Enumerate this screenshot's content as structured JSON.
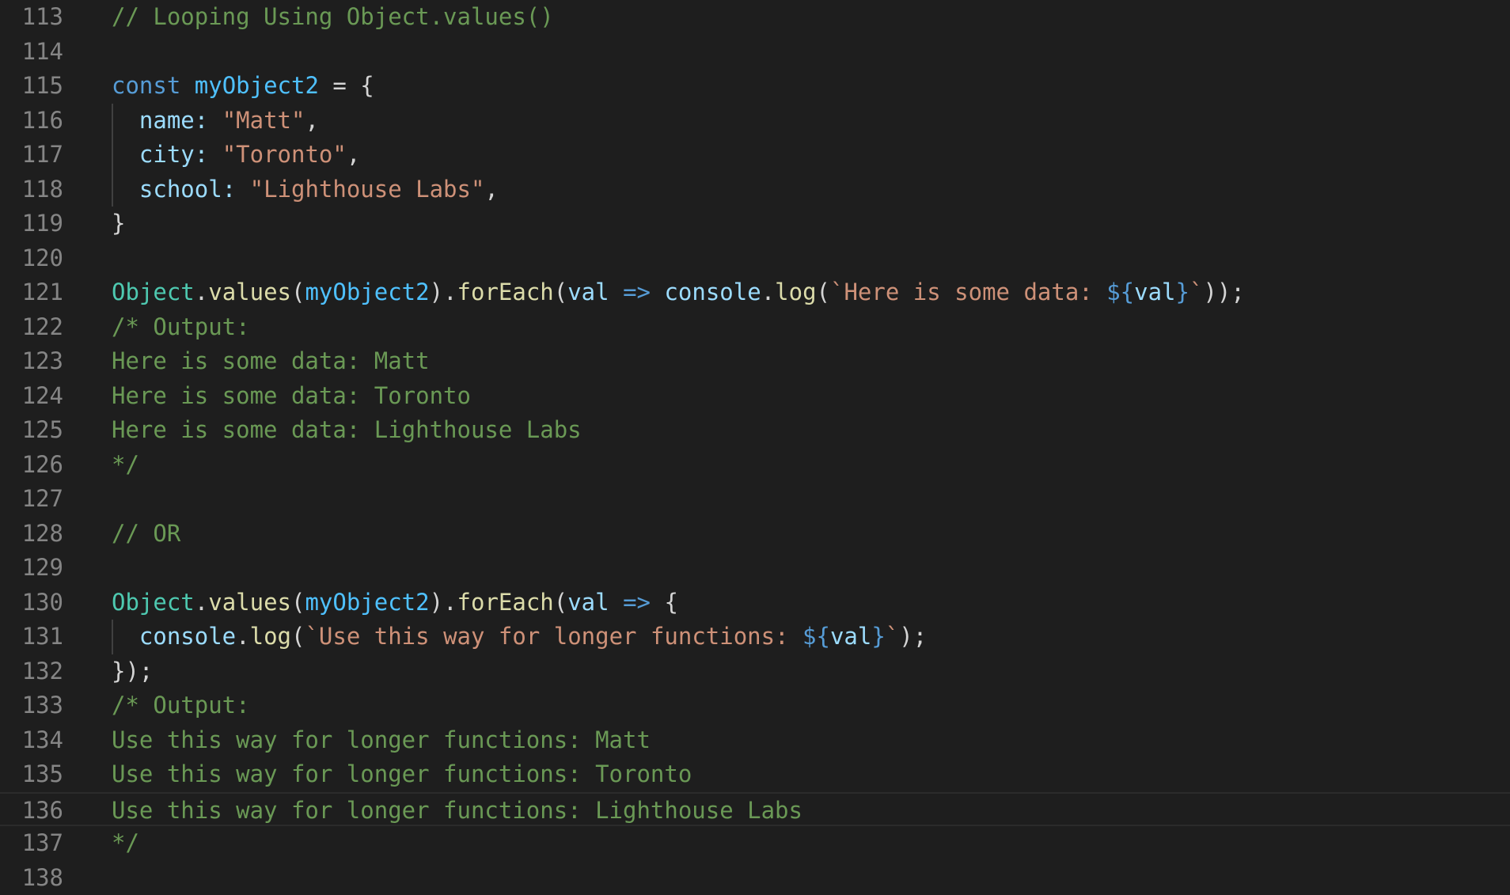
{
  "editor": {
    "colors": {
      "background": "#1e1e1e",
      "line_number": "#858585",
      "comment": "#6a9955",
      "keyword": "#569cd6",
      "variable": "#4fc1ff",
      "parameter": "#9cdcfe",
      "string": "#ce9178",
      "class": "#4ec9b0",
      "function": "#dcdcaa",
      "plain": "#d4d4d4"
    },
    "current_line": 136,
    "lines": [
      {
        "number": "113",
        "tokens": [
          {
            "t": "// Looping Using Object.values()",
            "c": "comment"
          }
        ]
      },
      {
        "number": "114",
        "tokens": []
      },
      {
        "number": "115",
        "tokens": [
          {
            "t": "const",
            "c": "keyword"
          },
          {
            "t": " ",
            "c": "plain"
          },
          {
            "t": "myObject2",
            "c": "var"
          },
          {
            "t": " = {",
            "c": "plain"
          }
        ]
      },
      {
        "number": "116",
        "guide": true,
        "tokens": [
          {
            "t": "  ",
            "c": "plain"
          },
          {
            "t": "name",
            "c": "param"
          },
          {
            "t": ": ",
            "c": "param"
          },
          {
            "t": "\"Matt\"",
            "c": "string"
          },
          {
            "t": ",",
            "c": "plain"
          }
        ]
      },
      {
        "number": "117",
        "guide": true,
        "tokens": [
          {
            "t": "  ",
            "c": "plain"
          },
          {
            "t": "city",
            "c": "param"
          },
          {
            "t": ": ",
            "c": "param"
          },
          {
            "t": "\"Toronto\"",
            "c": "string"
          },
          {
            "t": ",",
            "c": "plain"
          }
        ]
      },
      {
        "number": "118",
        "guide": true,
        "tokens": [
          {
            "t": "  ",
            "c": "plain"
          },
          {
            "t": "school",
            "c": "param"
          },
          {
            "t": ": ",
            "c": "param"
          },
          {
            "t": "\"Lighthouse Labs\"",
            "c": "string"
          },
          {
            "t": ",",
            "c": "plain"
          }
        ]
      },
      {
        "number": "119",
        "tokens": [
          {
            "t": "}",
            "c": "plain"
          }
        ]
      },
      {
        "number": "120",
        "tokens": []
      },
      {
        "number": "121",
        "tokens": [
          {
            "t": "Object",
            "c": "class"
          },
          {
            "t": ".",
            "c": "plain"
          },
          {
            "t": "values",
            "c": "func"
          },
          {
            "t": "(",
            "c": "plain"
          },
          {
            "t": "myObject2",
            "c": "var"
          },
          {
            "t": ").",
            "c": "plain"
          },
          {
            "t": "forEach",
            "c": "func"
          },
          {
            "t": "(",
            "c": "plain"
          },
          {
            "t": "val",
            "c": "param"
          },
          {
            "t": " ",
            "c": "plain"
          },
          {
            "t": "=>",
            "c": "keyword"
          },
          {
            "t": " ",
            "c": "plain"
          },
          {
            "t": "console",
            "c": "param"
          },
          {
            "t": ".",
            "c": "plain"
          },
          {
            "t": "log",
            "c": "func"
          },
          {
            "t": "(",
            "c": "plain"
          },
          {
            "t": "`Here is some data: ",
            "c": "string"
          },
          {
            "t": "${",
            "c": "keyword"
          },
          {
            "t": "val",
            "c": "param"
          },
          {
            "t": "}",
            "c": "keyword"
          },
          {
            "t": "`",
            "c": "string"
          },
          {
            "t": "));",
            "c": "plain"
          }
        ]
      },
      {
        "number": "122",
        "tokens": [
          {
            "t": "/* Output:",
            "c": "comment"
          }
        ]
      },
      {
        "number": "123",
        "tokens": [
          {
            "t": "Here is some data: Matt",
            "c": "comment"
          }
        ]
      },
      {
        "number": "124",
        "tokens": [
          {
            "t": "Here is some data: Toronto",
            "c": "comment"
          }
        ]
      },
      {
        "number": "125",
        "tokens": [
          {
            "t": "Here is some data: Lighthouse Labs",
            "c": "comment"
          }
        ]
      },
      {
        "number": "126",
        "tokens": [
          {
            "t": "*/",
            "c": "comment"
          }
        ]
      },
      {
        "number": "127",
        "tokens": []
      },
      {
        "number": "128",
        "tokens": [
          {
            "t": "// OR",
            "c": "comment"
          }
        ]
      },
      {
        "number": "129",
        "tokens": []
      },
      {
        "number": "130",
        "tokens": [
          {
            "t": "Object",
            "c": "class"
          },
          {
            "t": ".",
            "c": "plain"
          },
          {
            "t": "values",
            "c": "func"
          },
          {
            "t": "(",
            "c": "plain"
          },
          {
            "t": "myObject2",
            "c": "var"
          },
          {
            "t": ").",
            "c": "plain"
          },
          {
            "t": "forEach",
            "c": "func"
          },
          {
            "t": "(",
            "c": "plain"
          },
          {
            "t": "val",
            "c": "param"
          },
          {
            "t": " ",
            "c": "plain"
          },
          {
            "t": "=>",
            "c": "keyword"
          },
          {
            "t": " {",
            "c": "plain"
          }
        ]
      },
      {
        "number": "131",
        "guide": true,
        "tokens": [
          {
            "t": "  ",
            "c": "plain"
          },
          {
            "t": "console",
            "c": "param"
          },
          {
            "t": ".",
            "c": "plain"
          },
          {
            "t": "log",
            "c": "func"
          },
          {
            "t": "(",
            "c": "plain"
          },
          {
            "t": "`Use this way for longer functions: ",
            "c": "string"
          },
          {
            "t": "${",
            "c": "keyword"
          },
          {
            "t": "val",
            "c": "param"
          },
          {
            "t": "}",
            "c": "keyword"
          },
          {
            "t": "`",
            "c": "string"
          },
          {
            "t": ");",
            "c": "plain"
          }
        ]
      },
      {
        "number": "132",
        "tokens": [
          {
            "t": "});",
            "c": "plain"
          }
        ]
      },
      {
        "number": "133",
        "tokens": [
          {
            "t": "/* Output:",
            "c": "comment"
          }
        ]
      },
      {
        "number": "134",
        "tokens": [
          {
            "t": "Use this way for longer functions: Matt",
            "c": "comment"
          }
        ]
      },
      {
        "number": "135",
        "tokens": [
          {
            "t": "Use this way for longer functions: Toronto",
            "c": "comment"
          }
        ]
      },
      {
        "number": "136",
        "tokens": [
          {
            "t": "Use this way for longer functions: Lighthouse Labs",
            "c": "comment"
          }
        ]
      },
      {
        "number": "137",
        "tokens": [
          {
            "t": "*/",
            "c": "comment"
          }
        ]
      },
      {
        "number": "138",
        "tokens": []
      }
    ]
  }
}
